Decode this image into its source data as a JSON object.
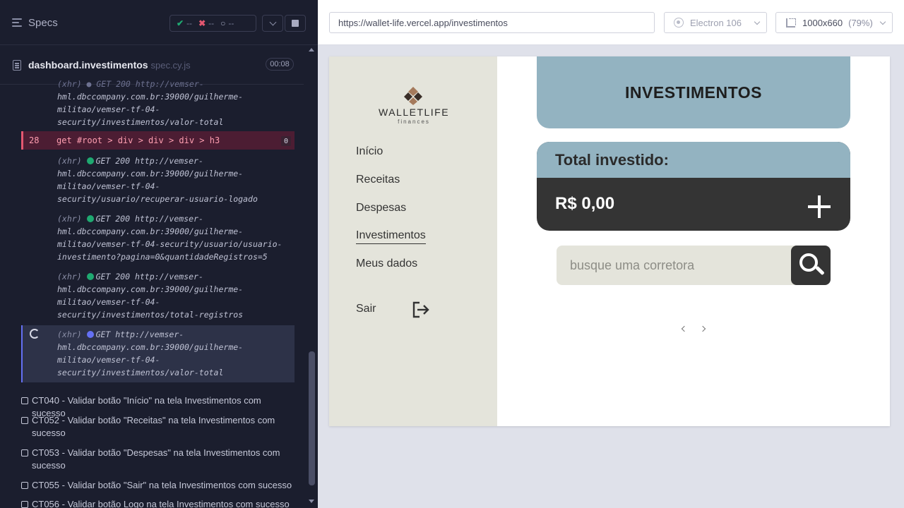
{
  "runner": {
    "header": {
      "title": "Specs"
    },
    "stats": {
      "passed": "--",
      "failed": "--",
      "pending": "--"
    },
    "spec": {
      "name": "dashboard.investimentos",
      "ext": "spec.cy.js",
      "time": "00:08"
    },
    "logs": {
      "top_partial": [
        "(xhr)  ● GET 200 http://vemser-",
        "hml.dbccompany.com.br:39000/guilherme-",
        "militao/vemser-tf-04-",
        "security/investimentos/valor-total"
      ],
      "command": {
        "num": "28",
        "text": "get  #root > div > div > div > h3",
        "count": "0"
      },
      "xhr1": {
        "tag": "(xhr)",
        "line1": "GET 200 http://vemser-",
        "rest": [
          "hml.dbccompany.com.br:39000/guilherme-",
          "militao/vemser-tf-04-",
          "security/usuario/recuperar-usuario-logado"
        ]
      },
      "xhr2": {
        "tag": "(xhr)",
        "line1": "GET 200 http://vemser-",
        "rest": [
          "hml.dbccompany.com.br:39000/guilherme-",
          "militao/vemser-tf-04-security/usuario/usuario-",
          "investimento?pagina=0&quantidadeRegistros=5"
        ]
      },
      "xhr3": {
        "tag": "(xhr)",
        "line1": "GET 200 http://vemser-",
        "rest": [
          "hml.dbccompany.com.br:39000/guilherme-",
          "militao/vemser-tf-04-",
          "security/investimentos/total-registros"
        ]
      },
      "xhr4": {
        "tag": "(xhr)",
        "line1": "GET http://vemser-",
        "rest": [
          "hml.dbccompany.com.br:39000/guilherme-",
          "militao/vemser-tf-04-",
          "security/investimentos/valor-total"
        ]
      }
    },
    "tests": [
      "CT040 - Validar botão \"Início\" na tela Investimentos com sucesso",
      "CT052 - Validar botão \"Receitas\" na tela Investimentos com sucesso",
      "CT053 - Validar botão \"Despesas\" na tela Investimentos com sucesso",
      "CT055 - Validar botão \"Sair\" na tela Investimentos com sucesso",
      "CT056 - Validar botão Logo na tela Investimentos com sucesso"
    ]
  },
  "browser": {
    "url": "https://wallet-life.vercel.app/investimentos",
    "engine": "Electron 106",
    "viewport": "1000x660",
    "zoom": "(79%)"
  },
  "app": {
    "logo": {
      "name": "WALLETLIFE",
      "sub": "finances"
    },
    "nav": [
      "Início",
      "Receitas",
      "Despesas",
      "Investimentos",
      "Meus dados"
    ],
    "active_nav": "Investimentos",
    "logout": "Sair",
    "page_title": "INVESTIMENTOS",
    "total_label": "Total investido:",
    "total_value": "R$ 0,00",
    "search_placeholder": "busque uma corretora",
    "colors": {
      "card_blue": "#93b3c1",
      "dark": "#343434",
      "sidebar": "#e4e4db"
    }
  }
}
